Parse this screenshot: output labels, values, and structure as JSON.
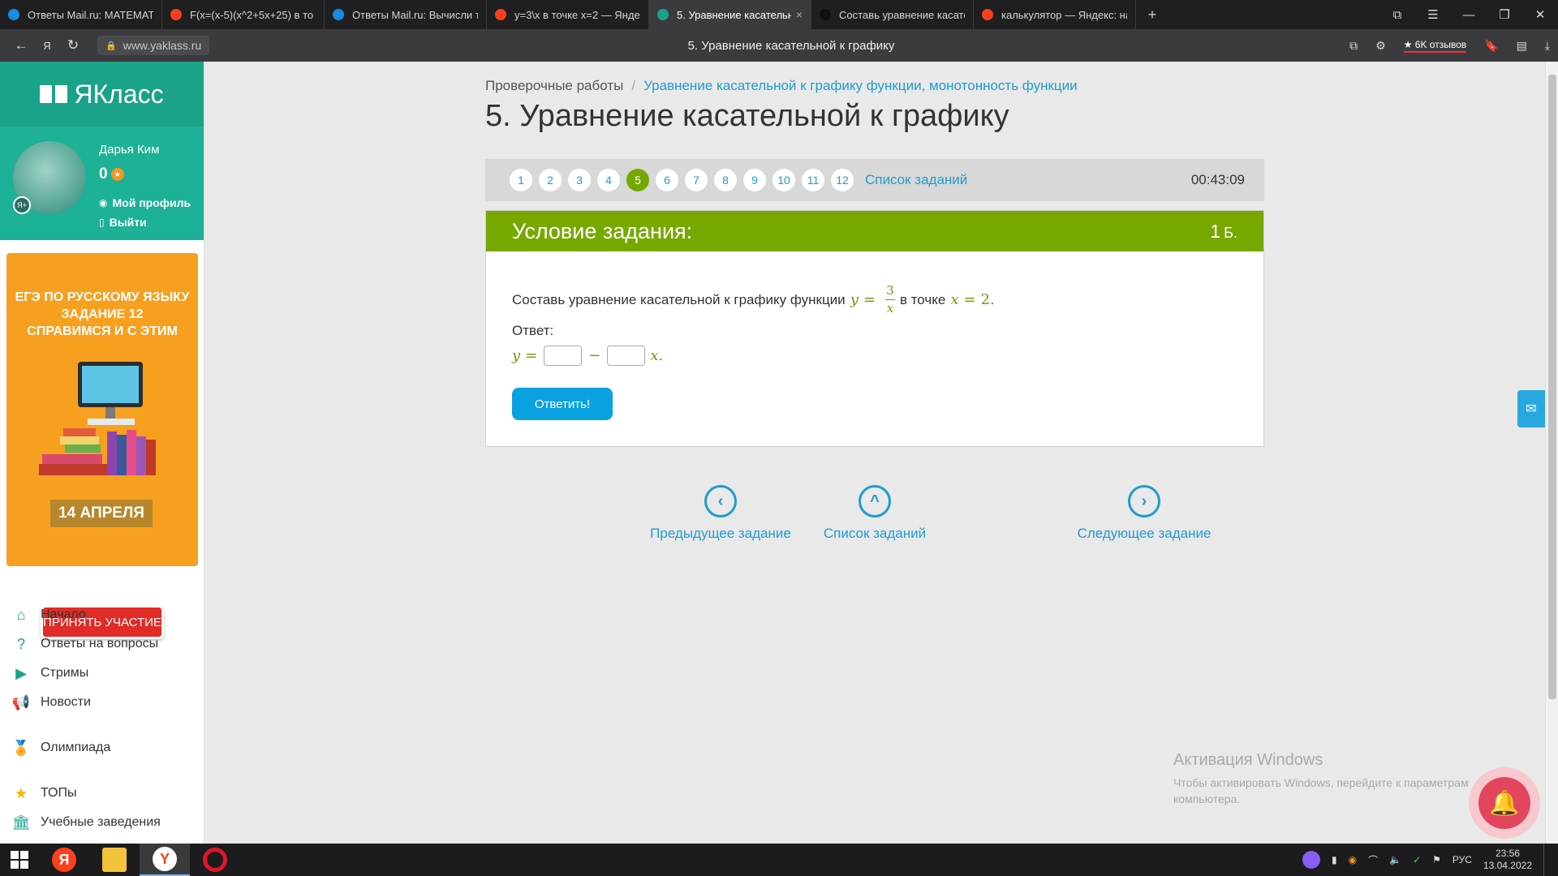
{
  "browser": {
    "tabs": [
      {
        "title": "Ответы Mail.ru: МАТЕМАТ",
        "icon": "mailru-icon",
        "color": "#168de2"
      },
      {
        "title": "F(x=(x-5)(x^2+5x+25) в то",
        "icon": "yandex-icon",
        "color": "#fc3f1d"
      },
      {
        "title": "Ответы Mail.ru: Вычисли т",
        "icon": "mailru-icon",
        "color": "#168de2"
      },
      {
        "title": "y=3\\x в точке x=2 — Янде",
        "icon": "yandex-icon",
        "color": "#fc3f1d"
      },
      {
        "title": "5. Уравнение касательн",
        "icon": "yaklass-icon",
        "color": "#1aa389",
        "active": true
      },
      {
        "title": "Составь уравнение касате",
        "icon": "z-icon",
        "color": "#111111"
      },
      {
        "title": "калькулятор — Яндекс: на",
        "icon": "yandex-icon",
        "color": "#fc3f1d"
      }
    ],
    "url": "www.yaklass.ru",
    "page_title": "5. Уравнение касательной к графику",
    "reviews": "6K отзывов"
  },
  "sidebar": {
    "logo": "ЯКласс",
    "user_name": "Дарья Ким",
    "points": "0",
    "profile_link": "Мой профиль",
    "logout_link": "Выйти",
    "ad": {
      "lines": [
        "ЕГЭ ПО РУССКОМУ ЯЗЫКУ",
        "ЗАДАНИЕ 12",
        "СПРАВИМСЯ И С ЭТИМ"
      ],
      "date": "14 АПРЕЛЯ",
      "button": "ПРИНЯТЬ УЧАСТИЕ"
    },
    "nav": [
      {
        "label": "Начало",
        "icon": "home-icon"
      },
      {
        "label": "Ответы на вопросы",
        "icon": "question-icon"
      },
      {
        "label": "Стримы",
        "icon": "play-icon"
      },
      {
        "label": "Новости",
        "icon": "megaphone-icon"
      },
      {
        "label": "Олимпиада",
        "icon": "medal-icon"
      },
      {
        "label": "ТОПы",
        "icon": "star-icon"
      },
      {
        "label": "Учебные заведения",
        "icon": "building-icon"
      }
    ]
  },
  "main": {
    "breadcrumb_root": "Проверочные работы",
    "breadcrumb_sep": "/",
    "breadcrumb_link": "Уравнение касательной к графику функции, монотонность функции",
    "title": "5. Уравнение касательной к графику",
    "task_numbers": [
      "1",
      "2",
      "3",
      "4",
      "5",
      "6",
      "7",
      "8",
      "9",
      "10",
      "11",
      "12"
    ],
    "current_task": "5",
    "task_list_link": "Список заданий",
    "timer": "00:43:09",
    "card": {
      "heading": "Условие задания:",
      "points": "1",
      "points_unit": "Б.",
      "question_text": "Составь уравнение касательной к графику функции",
      "func_lhs": "y",
      "func_eq": "=",
      "func_num": "3",
      "func_den": "x",
      "point_text": "в точке",
      "point_var": "x",
      "point_eq": "=",
      "point_val": "2.",
      "answer_label": "Ответ:",
      "answer_lhs": "y",
      "answer_eq": "=",
      "answer_minus": "−",
      "answer_var": "x.",
      "submit": "Ответить!"
    },
    "bottom_nav": {
      "prev": "Предыдущее задание",
      "list": "Список заданий",
      "next": "Следующее задание"
    },
    "watermark": {
      "title": "Активация Windows",
      "text": "Чтобы активировать Windows, перейдите к параметрам компьютера."
    }
  },
  "taskbar": {
    "lang": "РУС",
    "time": "23:56",
    "date": "13.04.2022"
  }
}
